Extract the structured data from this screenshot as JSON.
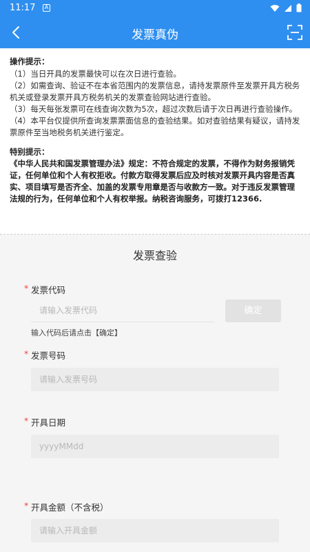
{
  "status_bar": {
    "time": "11:17",
    "notification_glyph": "A",
    "icons": [
      "wifi-icon",
      "signal-icon",
      "battery-icon"
    ]
  },
  "app_bar": {
    "title": "发票真伪",
    "back_icon": "chevron-left-icon",
    "scan_icon": "scan-icon",
    "color": "#2f8ff0"
  },
  "tips": {
    "heading": "操作提示：",
    "items": [
      "（1）当日开具的发票最快可以在次日进行查验。",
      "（2）如需查询、验证不在本省范围内的发票信息，请持发票原件至发票开具方税务机关或登录发票开具方税务机关的发票查验网站进行查验。",
      "（3）每天每张发票可在线查询次数为5次，超过次数后请于次日再进行查验操作。",
      "（4）本平台仅提供所查询发票票面信息的查验结果。如对查验结果有疑议，请持发票原件至当地税务机关进行鉴定。"
    ],
    "special_heading": "特别提示：",
    "special_text": "《中华人民共和国发票管理办法》规定：不符合规定的发票，不得作为财务报销凭证，任何单位和个人有权拒收。付款方取得发票后应及时核对发票开具内容是否真实、项目填写是否齐全、加盖的发票专用章是否与收款方一致。对于违反发票管理法规的行为，任何单位和个人有权举报。纳税咨询服务，可拨打12366."
  },
  "form": {
    "title": "发票查验",
    "required_mark": "*",
    "invoice_code": {
      "label": "发票代码",
      "placeholder": "请输入发票代码",
      "value": ""
    },
    "confirm_label": "确定",
    "code_hint": "输入代码后请点击【确定】",
    "invoice_number": {
      "label": "发票号码",
      "placeholder": "请输入发票号码",
      "value": ""
    },
    "issue_date": {
      "label": "开具日期",
      "placeholder": "yyyyMMdd",
      "value": ""
    },
    "amount": {
      "label": "开具金额（不含税）",
      "placeholder": "请输入开具金额",
      "value": ""
    }
  }
}
